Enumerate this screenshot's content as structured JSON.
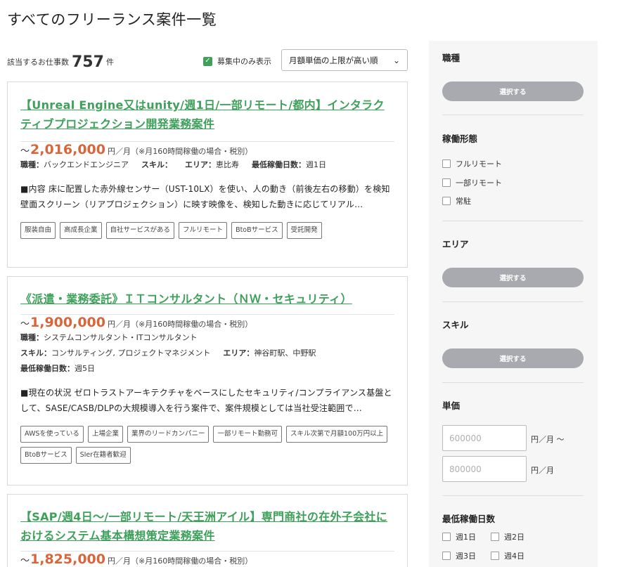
{
  "page": {
    "title": "すべてのフリーランス案件一覧"
  },
  "toolbar": {
    "count_label": "該当するお仕事数",
    "count": "757",
    "count_unit": "件",
    "recruiting_only_label": "募集中のみ表示",
    "recruiting_only_checked": true,
    "sort_selected": "月額単価の上限が高い順"
  },
  "jobs": [
    {
      "title": "【Unreal Engine又はunity/週1日/一部リモート/都内】インタラクティブプロジェクション開発業務案件",
      "price_prefix": "～",
      "price": "2,016,000",
      "price_unit": "円／月（※月160時間稼働の場合・税別）",
      "role_label": "職種：",
      "role": "バックエンドエンジニア",
      "skill_label": "スキル：",
      "skill": "",
      "area_label": "エリア：",
      "area": "恵比寿",
      "days_label": "最低稼働日数：",
      "days": "週1日",
      "description": "■内容 床に配置した赤外線センサー（UST-10LX）を使い、人の動き（前後左右の移動）を検知 壁面スクリーン（リアプロジェクション）に映す映像を、検知した動きに応じてリアル…",
      "tags": [
        "服装自由",
        "高成長企業",
        "自社サービスがある",
        "フルリモート",
        "BtoBサービス",
        "受託開発"
      ]
    },
    {
      "title": "《派遣・業務委託》ＩＴコンサルタント（ＮＷ・セキュリティ）",
      "price_prefix": "～",
      "price": "1,900,000",
      "price_unit": "円／月（※月160時間稼働の場合・税別）",
      "role_label": "職種：",
      "role": "システムコンサルタント・ITコンサルタント",
      "skill_label": "スキル：",
      "skill": "コンサルティング, プロジェクトマネジメント",
      "area_label": "エリア：",
      "area": "神谷町駅、中野駅",
      "days_label": "最低稼働日数：",
      "days": "週5日",
      "description": "■現在の状況 ゼロトラストアーキテクチャをベースにしたセキュリティ/コンプライアンス基盤として、SASE/CASB/DLPの大規模導入を行う案件で、案件規模としては当社受注範囲で…",
      "tags": [
        "AWSを使っている",
        "上場企業",
        "業界のリードカンパニー",
        "一部リモート勤務可",
        "スキル次第で月額100万円以上",
        "BtoBサービス",
        "SIer在籍者歓迎"
      ]
    },
    {
      "title": "【SAP/週4日～/一部リモート/天王洲アイル】専門商社の在外子会社におけるシステム基本構想策定業務案件",
      "price_prefix": "～",
      "price": "1,825,000",
      "price_unit": "円／月（※月160時間稼働の場合・税別）"
    }
  ],
  "sidebar": {
    "job_type": {
      "heading": "職種",
      "button": "選択する"
    },
    "work_style": {
      "heading": "稼働形態",
      "options": [
        "フルリモート",
        "一部リモート",
        "常駐"
      ]
    },
    "area": {
      "heading": "エリア",
      "button": "選択する"
    },
    "skill": {
      "heading": "スキル",
      "button": "選択する"
    },
    "price": {
      "heading": "単価",
      "min_placeholder": "600000",
      "min_unit": "円／月 ～",
      "max_placeholder": "800000",
      "max_unit": "円／月"
    },
    "min_days": {
      "heading": "最低稼働日数",
      "options": [
        "週1日",
        "週2日",
        "週3日",
        "週4日"
      ]
    }
  },
  "colors": {
    "accent": "#3ea05a",
    "price": "#d9653b",
    "sidebar_button": "#a9aab0"
  }
}
